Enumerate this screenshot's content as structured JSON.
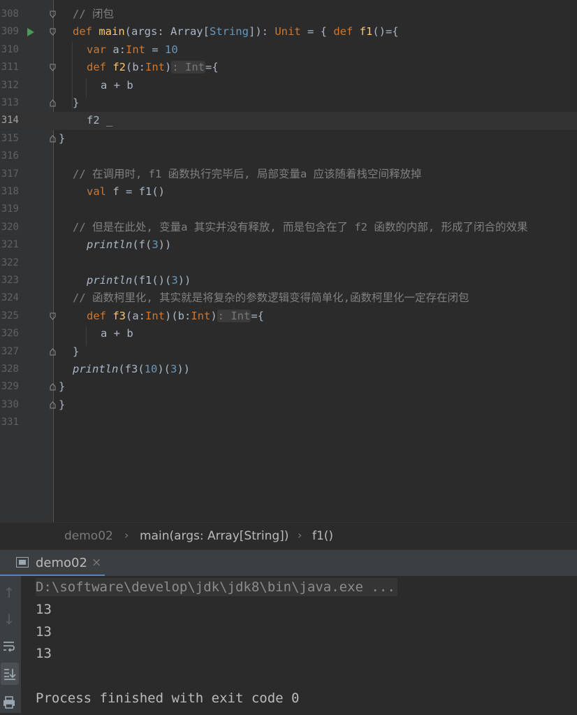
{
  "editor": {
    "first_line_partial": "//}",
    "lines": [
      {
        "no": "308"
      },
      {
        "no": "309"
      },
      {
        "no": "310"
      },
      {
        "no": "311"
      },
      {
        "no": "312"
      },
      {
        "no": "313"
      },
      {
        "no": "314"
      },
      {
        "no": "315"
      },
      {
        "no": "316"
      },
      {
        "no": "317"
      },
      {
        "no": "318"
      },
      {
        "no": "319"
      },
      {
        "no": "320"
      },
      {
        "no": "321"
      },
      {
        "no": "322"
      },
      {
        "no": "323"
      },
      {
        "no": "324"
      },
      {
        "no": "325"
      },
      {
        "no": "326"
      },
      {
        "no": "327"
      },
      {
        "no": "328"
      },
      {
        "no": "329"
      },
      {
        "no": "330"
      },
      {
        "no": "331"
      }
    ],
    "code": {
      "l308_comment": "// 闭包",
      "l309_def": "def ",
      "l309_main": "main",
      "l309_args": "(args: Array[",
      "l309_string": "String",
      "l309_close": "]): ",
      "l309_unit": "Unit",
      "l309_eq": " = { ",
      "l309_def2": "def ",
      "l309_f1": "f1",
      "l309_tail": "()={",
      "l310_var": "var ",
      "l310_a": "a:",
      "l310_int": "Int",
      "l310_eq": " = ",
      "l310_num": "10",
      "l311_def": "def ",
      "l311_f2": "f2",
      "l311_args": "(b:",
      "l311_int": "Int",
      "l311_close": ")",
      "l311_hint": ": Int",
      "l311_tail": "={",
      "l312_expr": "a + b",
      "l313_brace": "}",
      "l314_expr": "f2 _",
      "l315_brace": "}",
      "l317_comment": "// 在调用时, f1 函数执行完毕后, 局部变量a 应该随着栈空间释放掉",
      "l318_val": "val ",
      "l318_rest": "f = f1()",
      "l320_comment": "// 但是在此处, 变量a 其实并没有释放, 而是包含在了 f2 函数的内部, 形成了闭合的效果",
      "l321_println": "println",
      "l321_open": "(f(",
      "l321_num": "3",
      "l321_close": "))",
      "l323_println": "println",
      "l323_open": "(f1()(",
      "l323_num": "3",
      "l323_close": "))",
      "l324_comment": "// 函数柯里化, 其实就是将复杂的参数逻辑变得简单化,函数柯里化一定存在闭包",
      "l325_def": "def ",
      "l325_f3": "f3",
      "l325_a": "(a:",
      "l325_int1": "Int",
      "l325_b": ")(b:",
      "l325_int2": "Int",
      "l325_close": ")",
      "l325_hint": ": Int",
      "l325_tail": "={",
      "l326_expr": "a + b",
      "l327_brace": "}",
      "l328_println": "println",
      "l328_open": "(f3(",
      "l328_num1": "10",
      "l328_mid": ")(",
      "l328_num2": "3",
      "l328_close": "))",
      "l329_brace": "}",
      "l330_brace": "}"
    }
  },
  "breadcrumb": {
    "items": [
      "demo02",
      "main(args: Array[String])",
      "f1()"
    ]
  },
  "run_panel": {
    "tab_label": "demo02",
    "tab_close": "×",
    "console": {
      "command": "D:\\software\\develop\\jdk\\jdk8\\bin\\java.exe ...",
      "outputs": [
        "13",
        "13",
        "13"
      ],
      "finish": "Process finished with exit code 0"
    }
  },
  "colors": {
    "keyword": "#cc7832",
    "function": "#ffc66d",
    "number": "#6897bb",
    "comment": "#808080",
    "text": "#a9b7c6",
    "run_icon": "#499c54"
  },
  "icons": [
    "run-icon",
    "fold-icon",
    "arrow-up-icon",
    "arrow-down-icon",
    "soft-wrap-icon",
    "scroll-to-end-icon",
    "print-icon",
    "console-tab-icon",
    "close-icon"
  ]
}
